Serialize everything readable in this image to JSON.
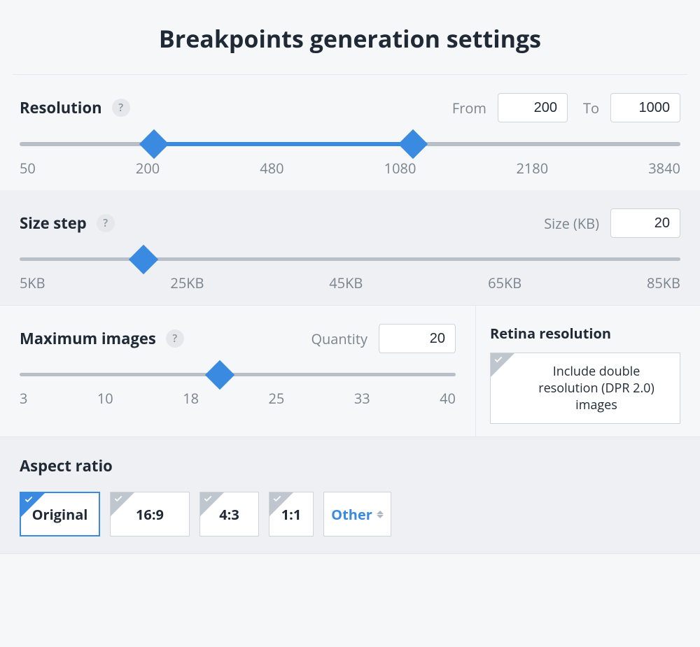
{
  "title": "Breakpoints generation settings",
  "resolution": {
    "label": "Resolution",
    "from_label": "From",
    "to_label": "To",
    "from_value": "200",
    "to_value": "1000",
    "ticks": [
      "50",
      "200",
      "480",
      "1080",
      "2180",
      "3840"
    ],
    "fill_left_pct": 20.3,
    "fill_right_pct": 59.5
  },
  "size_step": {
    "label": "Size step",
    "input_label": "Size (KB)",
    "value": "20",
    "ticks": [
      "5KB",
      "25KB",
      "45KB",
      "65KB",
      "85KB"
    ],
    "handle_pct": 18.8
  },
  "maximages": {
    "label": "Maximum images",
    "input_label": "Quantity",
    "value": "20",
    "ticks": [
      "3",
      "10",
      "18",
      "25",
      "33",
      "40"
    ],
    "handle_pct": 45.9
  },
  "retina": {
    "label": "Retina resolution",
    "card_text": "Include double resolution (DPR 2.0) images"
  },
  "aspect_ratio": {
    "label": "Aspect ratio",
    "options": {
      "original": "Original",
      "r169": "16:9",
      "r43": "4:3",
      "r11": "1:1",
      "other": "Other"
    }
  }
}
